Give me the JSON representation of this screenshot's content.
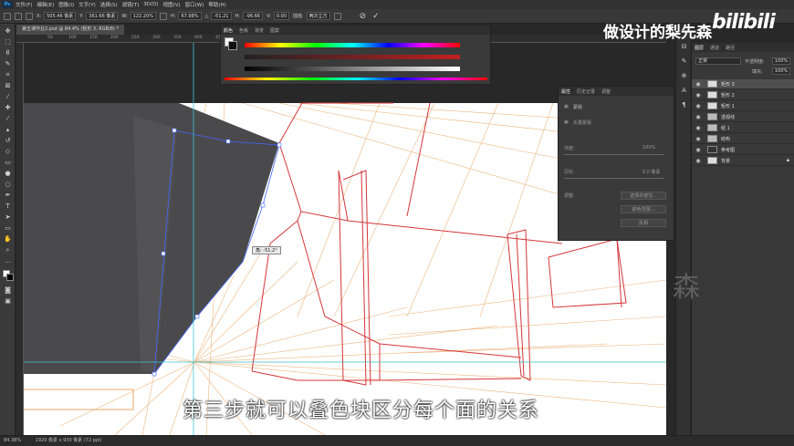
{
  "menubar": {
    "logo": "Ps",
    "items": [
      "文件(F)",
      "编辑(E)",
      "图像(I)",
      "文字(Y)",
      "选择(S)",
      "滤镜(T)",
      "3D(D)",
      "视图(V)",
      "窗口(W)",
      "帮助(H)"
    ]
  },
  "options": {
    "x_label": "X:",
    "x_value": "505.46 像素",
    "y_label": "Y:",
    "y_value": "361.66 像素",
    "w_label": "W:",
    "w_value": "122.20%",
    "h_label": "H:",
    "h_value": "67.98%",
    "angle_label": "△",
    "angle_value": "-51.21",
    "hskew_label": "H:",
    "hskew_value": "-96.66",
    "vskew_label": "V:",
    "vskew_value": "0.00",
    "interp_label": "插值:",
    "interp_value": "两次立方"
  },
  "document": {
    "tab_title": "第五课作业2.psd @ 84.4% (矩形 3, RGB/8) *"
  },
  "ruler": {
    "ticks": [
      "50",
      "100",
      "150",
      "200",
      "250",
      "300",
      "350",
      "400",
      "450",
      "500"
    ]
  },
  "color_panel": {
    "tabs": [
      "颜色",
      "色板",
      "渐变",
      "图案"
    ]
  },
  "properties_panel": {
    "tabs": [
      "属性",
      "历史记录",
      "调整"
    ],
    "row1": "蒙版",
    "row2": "矢量蒙版",
    "density_label": "浓度:",
    "density_value": "100%",
    "feather_label": "羽化:",
    "feather_value": "0.0 像素",
    "refine_label": "调整:",
    "select_btn": "选择并遮住...",
    "color_range_btn": "颜色范围...",
    "invert_btn": "反相"
  },
  "layers_panel": {
    "tabs": [
      "图层",
      "通道",
      "路径"
    ],
    "blend_mode": "正常",
    "opacity_label": "不透明度:",
    "opacity_value": "100%",
    "fill_label": "填充:",
    "fill_value": "100%",
    "layers": [
      {
        "name": "矩形 3",
        "selected": true
      },
      {
        "name": "矩形 2",
        "selected": false
      },
      {
        "name": "矩形 1",
        "selected": false
      },
      {
        "name": "透视线",
        "selected": false
      },
      {
        "name": "组 1",
        "selected": false
      },
      {
        "name": "结构",
        "selected": false
      },
      {
        "name": "参考图",
        "selected": false
      },
      {
        "name": "背景",
        "selected": false
      }
    ]
  },
  "transform_tooltip": "角: -51.2°",
  "status": {
    "zoom": "84.38%",
    "doc_info": "1920 像素 x 930 像素 (72 ppi)"
  },
  "overlay": {
    "channel_name": "做设计的梨先森",
    "platform_logo": "bilibili",
    "subtitle": "第三步就可以叠色块区分每个面的关系",
    "watermark_char": "森"
  },
  "colors": {
    "ui_bg": "#282828",
    "panel_bg": "#3a3a3a",
    "red_line": "#d4363a",
    "orange_line": "#e8a96a",
    "dark_shape": "#4a4a4c",
    "guide_cyan": "#38c8d8",
    "path_blue": "#4466ff"
  }
}
